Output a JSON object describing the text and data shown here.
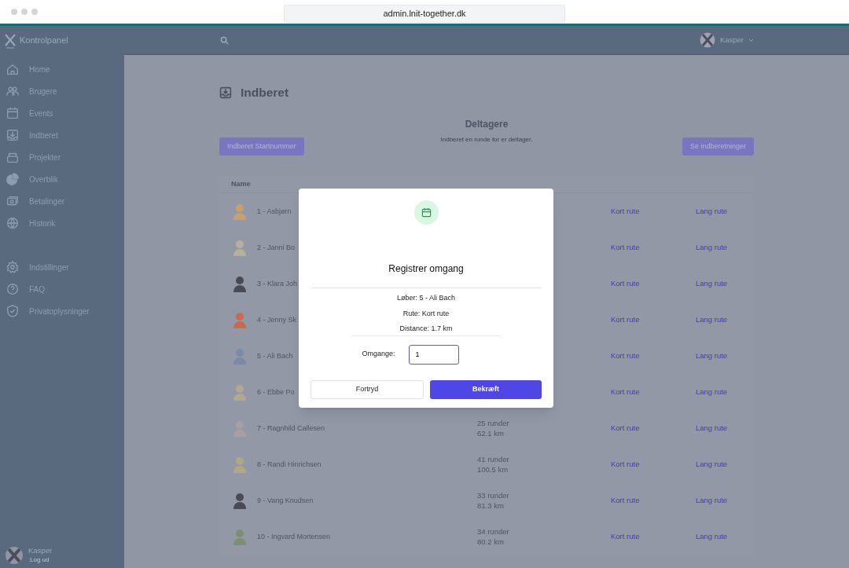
{
  "browser": {
    "url": "admin.lnit-together.dk"
  },
  "header": {
    "brand": "Kontrolpanel",
    "user": "Kasper"
  },
  "sidebar": {
    "items": [
      {
        "label": "Home",
        "selected": false
      },
      {
        "label": "Brugere",
        "selected": false
      },
      {
        "label": "Events",
        "selected": false
      },
      {
        "label": "Indberet",
        "selected": false
      },
      {
        "label": "Projekter",
        "selected": false
      },
      {
        "label": "Overblik",
        "selected": false
      }
    ],
    "items2": [
      {
        "label": "Betalinger",
        "selected": false
      },
      {
        "label": "Historik",
        "selected": false
      }
    ],
    "settings": [
      {
        "label": "Indstillinger",
        "selected": false
      },
      {
        "label": "FAQ",
        "selected": false
      },
      {
        "label": "Privatoplysninger",
        "selected": false
      }
    ],
    "user": {
      "name": "Kasper",
      "action": "Log ud"
    }
  },
  "page": {
    "title": "Indberet",
    "section_title": "Deltagere",
    "subtitle": "Indberet en runde for er deltager.",
    "left_button": "Indberet Startnummer",
    "right_button": "Se indberetninger"
  },
  "table": {
    "columns": [
      "Name"
    ],
    "rows": [
      {
        "name": "1 - Asbjørn",
        "short": "Kort rute",
        "long": "Lang rute"
      },
      {
        "name": "2 - Janni Bo",
        "short": "Kort rute",
        "long": "Lang rute"
      },
      {
        "name": "3 - Klara Joh",
        "short": "Kort rute",
        "long": "Lang rute"
      },
      {
        "name": "4 - Jenny Sk",
        "short": "Kort rute",
        "long": "Lang rute"
      },
      {
        "name": "5 - Ali Bach",
        "short": "Kort rute",
        "long": "Lang rute"
      },
      {
        "name": "6 - Ebbe Po",
        "short": "Kort rute",
        "long": "Lang rute"
      },
      {
        "name": "7 - Ragnhild Callesen",
        "laps": "25 runder",
        "distance": "62.1 km",
        "short": "Kort rute",
        "long": "Lang rute"
      },
      {
        "name": "8 - Randi Hinrichsen",
        "laps": "41 runder",
        "distance": "100.5 km",
        "short": "Kort rute",
        "long": "Lang rute"
      },
      {
        "name": "9 - Vang Knudsen",
        "laps": "33 runder",
        "distance": "81.3 km",
        "short": "Kort rute",
        "long": "Lang rute"
      },
      {
        "name": "10 - Ingvard Mortensen",
        "laps": "34 runder",
        "distance": "80.2 km",
        "short": "Kort rute",
        "long": "Lang rute"
      }
    ]
  },
  "dialog": {
    "title": "Registrer omgang",
    "lines": [
      "Løber: 5 - Ali Bach",
      "Rute: Kort rute",
      "Distance: 1.7 km"
    ],
    "field_label": "Omgange:",
    "field_value": "1",
    "cancel": "Fortryd",
    "confirm": "Bekræft"
  }
}
